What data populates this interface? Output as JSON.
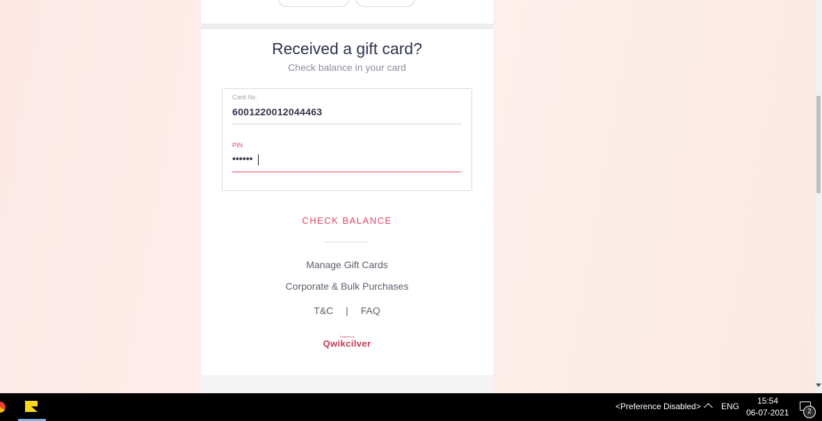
{
  "gift_card": {
    "title": "Received a gift card?",
    "subtitle": "Check balance in your card",
    "card_no_label": "Card No.",
    "card_no_value": "6001220012044463",
    "pin_label": "PIN",
    "pin_value": "••••••",
    "check_balance": "CHECK BALANCE"
  },
  "links": {
    "manage": "Manage Gift Cards",
    "corporate": "Corporate & Bulk Purchases",
    "tnc": "T&C",
    "separator": "|",
    "faq": "FAQ"
  },
  "brand": {
    "powered_by": "Powered by",
    "name": "Qwikcilver",
    "color": "#c63a4e"
  },
  "accent_color": "#e4405f",
  "taskbar": {
    "preference": "<Preference Disabled>",
    "language": "ENG",
    "time": "15:54",
    "date": "06-07-2021",
    "notification_count": "2"
  }
}
